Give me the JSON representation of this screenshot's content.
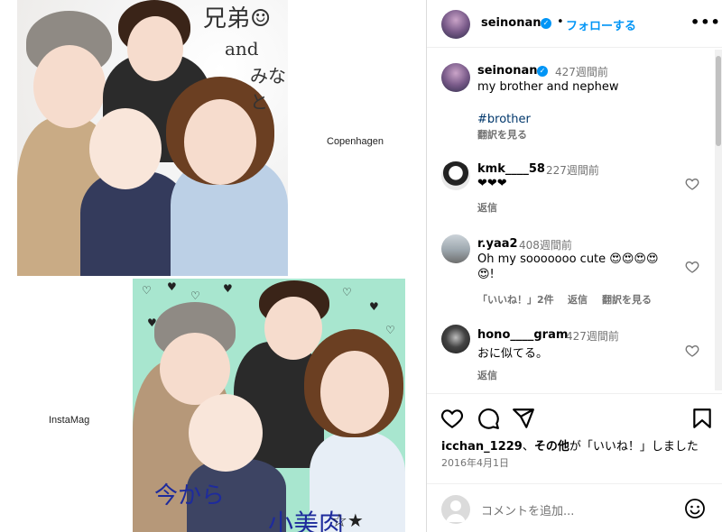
{
  "media": {
    "caption_top": "Copenhagen",
    "caption_bottom": "InstaMag",
    "scribble_top_1": "兄弟☺",
    "scribble_top_2": "and",
    "scribble_top_3": "みなと",
    "scribble_bottom": "今から",
    "scribble_bottom_2": "小美肉"
  },
  "header": {
    "username": "seinonana",
    "separator": "•",
    "follow_label": "フォローする",
    "more_label": "•••"
  },
  "post": {
    "username": "seinonana",
    "time": "427週間前",
    "caption": "my brother and nephew",
    "hashtag": "#brother",
    "translate_label": "翻訳を見る"
  },
  "comments": [
    {
      "username": "kmk____58",
      "time": "227週間前",
      "text": "❤❤❤",
      "reply": "返信",
      "likes": "",
      "translate": ""
    },
    {
      "username": "r.yaa2",
      "time": "408週間前",
      "text": "Oh my sooooooo cute 😍😍😍😍",
      "text2": "😍!",
      "likes": "「いいね！」2件",
      "reply": "返信",
      "translate": "翻訳を見る"
    },
    {
      "username": "hono____gram",
      "time": "427週間前",
      "text": "おに似てる。",
      "reply": "返信",
      "likes": "",
      "translate": ""
    }
  ],
  "actions": {
    "liked_by_user": "icchan_1229",
    "liked_middle": "、",
    "liked_others": "その他",
    "liked_suffix": "が「いいね！」しました",
    "date": "2016年4月1日"
  },
  "comment_box": {
    "placeholder": "コメントを追加..."
  },
  "icons": {
    "like": "heart-icon",
    "comment": "comment-icon",
    "share": "share-icon",
    "save": "bookmark-icon",
    "emoji": "emoji-icon",
    "verified": "verified-badge-icon"
  },
  "colors": {
    "accent": "#0095f6",
    "hashtag": "#00376b",
    "muted": "#737373",
    "photo_bg": "#a8e6cf"
  }
}
